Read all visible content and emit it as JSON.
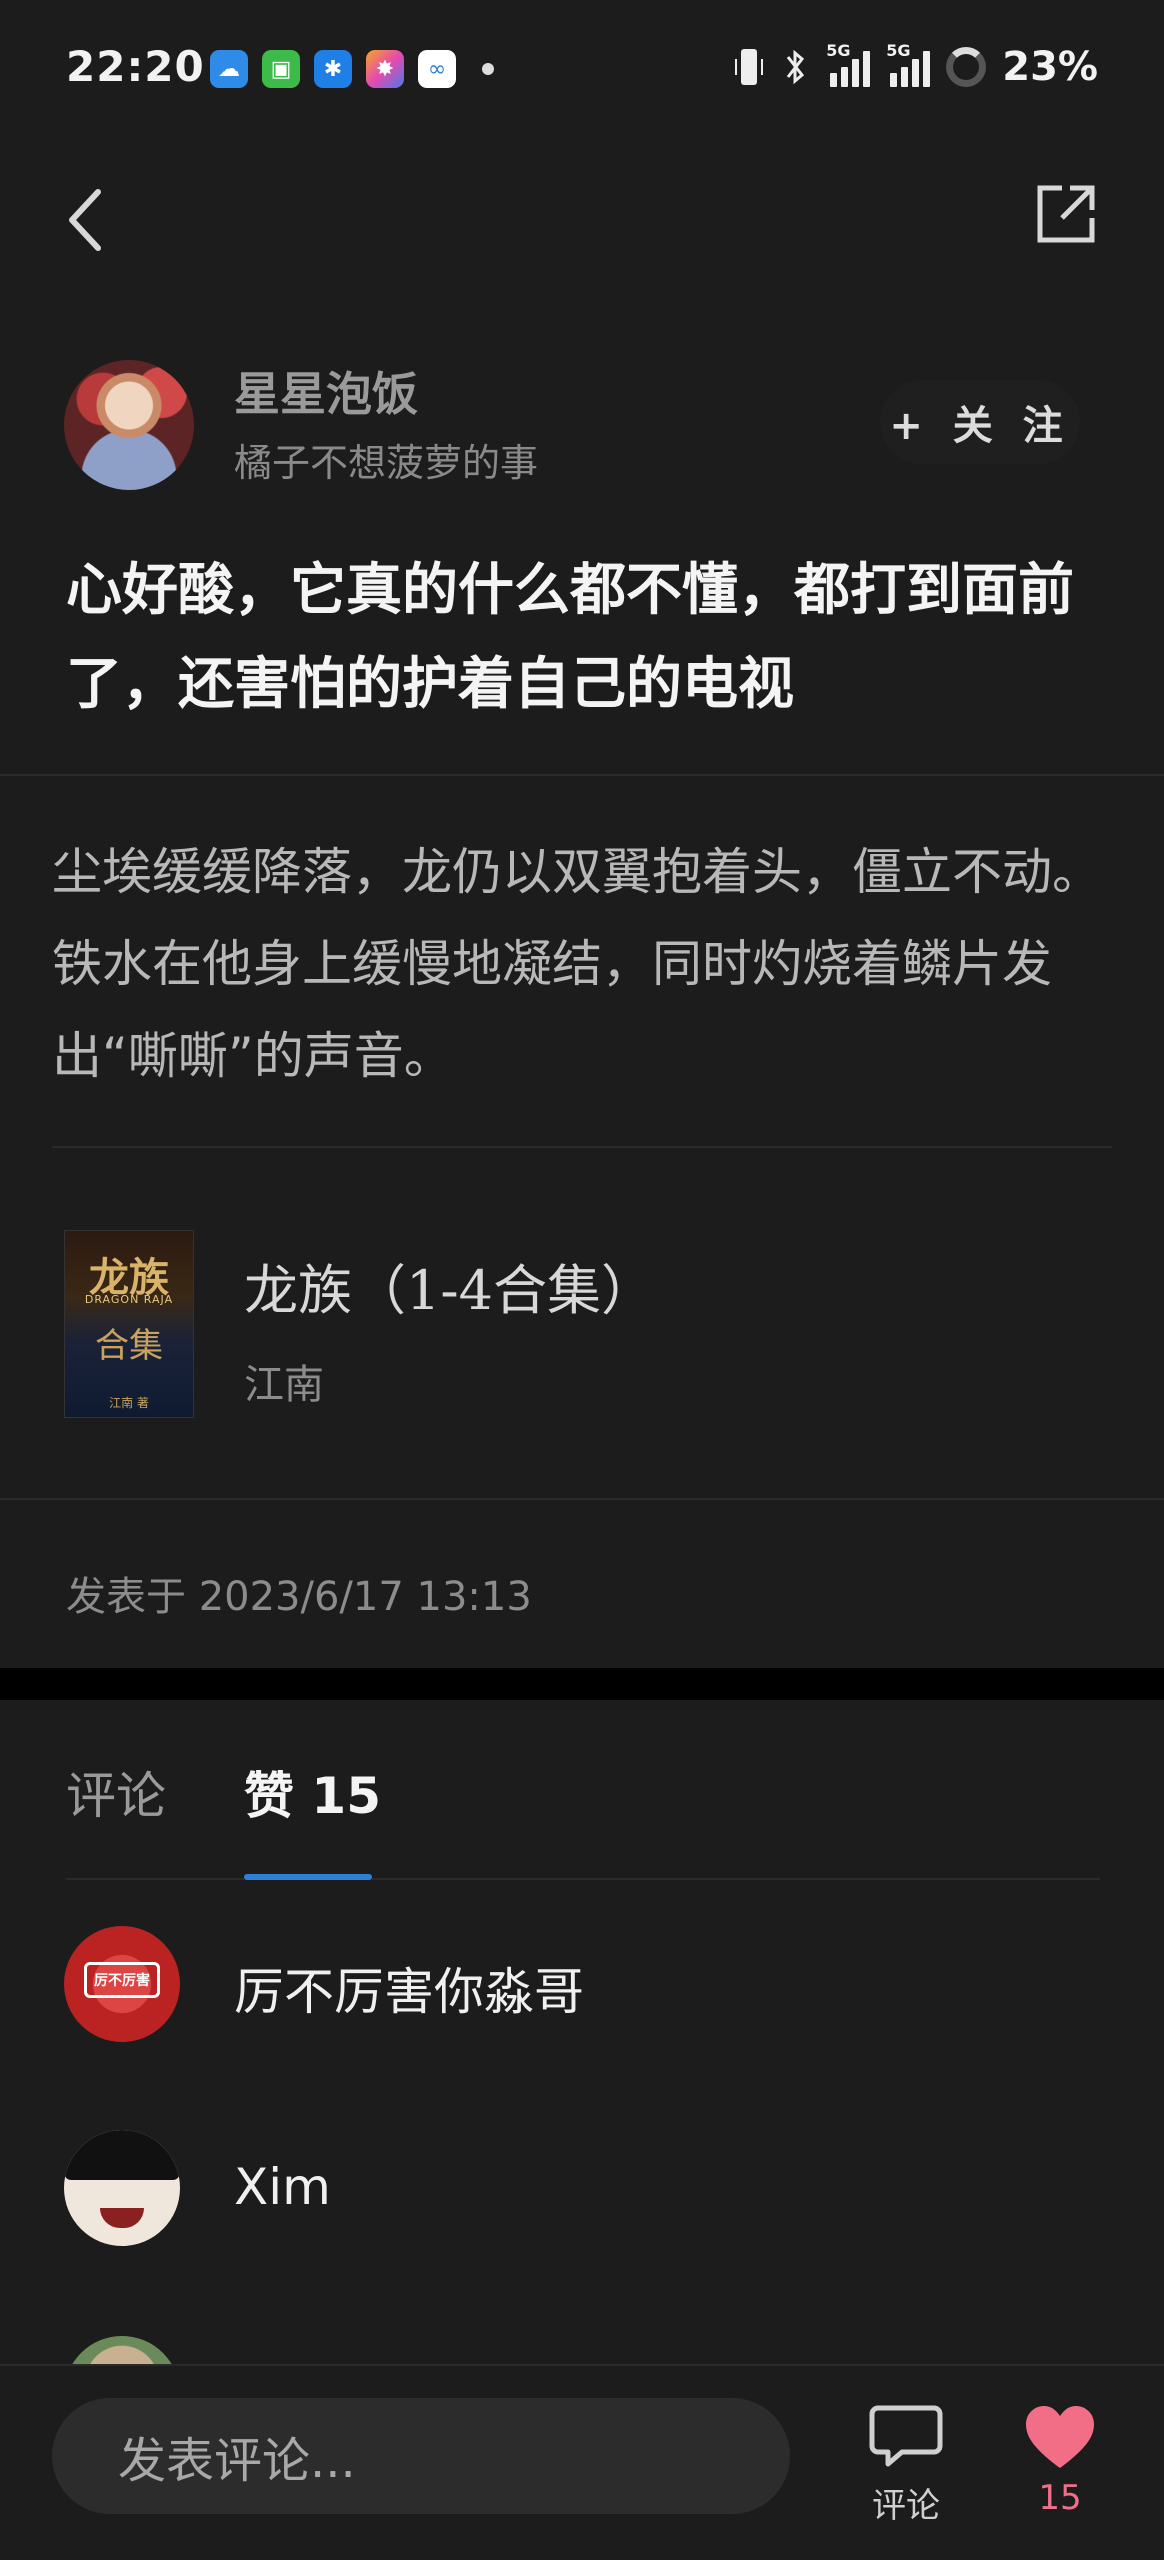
{
  "status_bar": {
    "time": "22:20",
    "battery": "23%",
    "network_1": "5G",
    "network_2": "5G"
  },
  "author": {
    "name": "星星泡饭",
    "subtitle": "橘子不想菠萝的事",
    "follow_label": "+ 关 注"
  },
  "post": {
    "text": "心好酸，它真的什么都不懂，都打到面前了，还害怕的护着自己的电视",
    "quote": "尘埃缓缓降落，龙仍以双翼抱着头，僵立不动。铁水在他身上缓慢地凝结，同时灼烧着鳞片发出“嘶嘶”的声音。",
    "date": "发表于 2023/6/17 13:13"
  },
  "book": {
    "title": "龙族（1-4合集）",
    "author": "江南",
    "cover_title": "龙族",
    "cover_subtitle": "DRAGON RAJA",
    "cover_heading": "合集",
    "cover_author": "江南 著"
  },
  "tabs": {
    "comments": "评论",
    "likes": "赞 15"
  },
  "likers": [
    {
      "name": "厉不厉害你淼哥",
      "avatar_text": "厉不厉害"
    },
    {
      "name": "Xim"
    }
  ],
  "bottom": {
    "comment_placeholder": "发表评论...",
    "comment_label": "评论",
    "like_count": "15"
  },
  "colors": {
    "background": "#1c1c1c",
    "accent_tab": "#2f7fd6",
    "like_heart": "#f26d86"
  }
}
